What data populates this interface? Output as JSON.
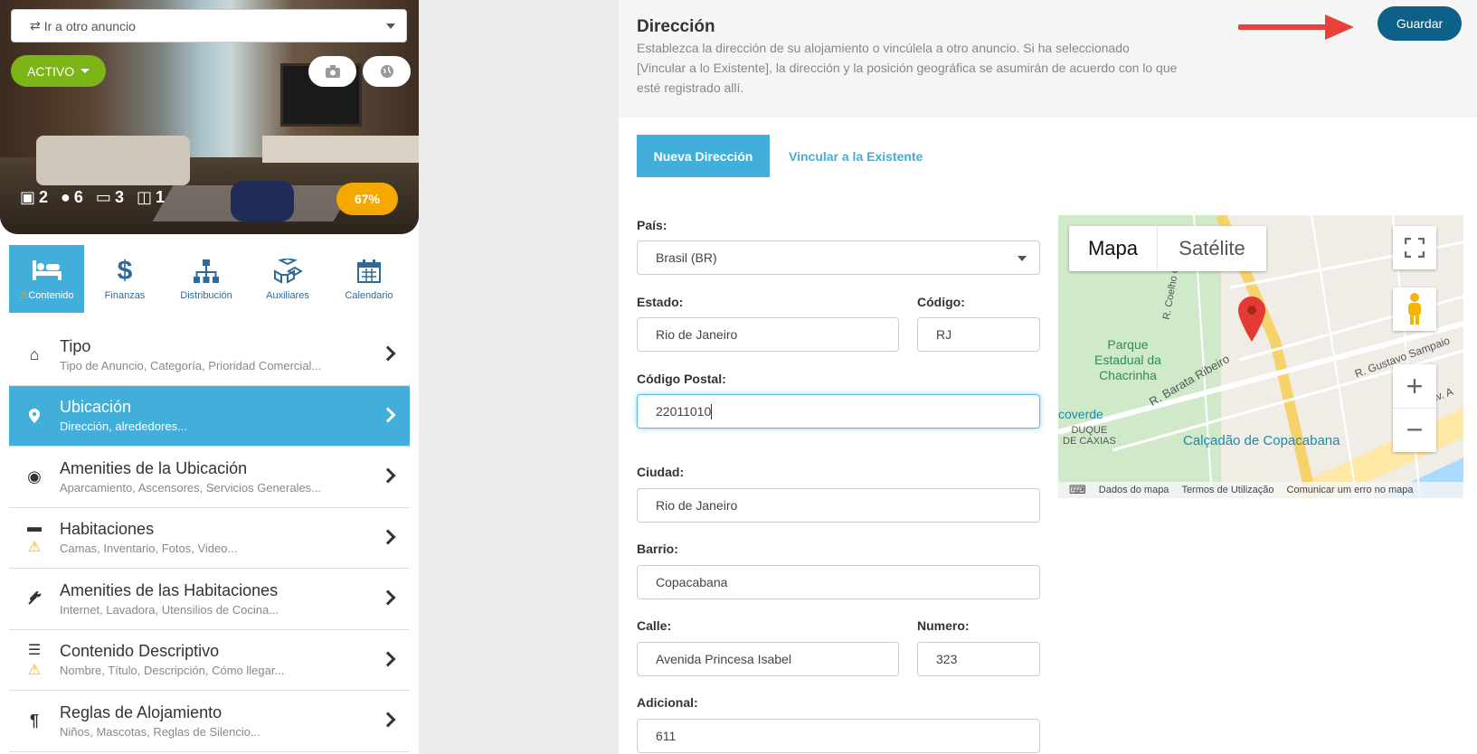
{
  "listing": {
    "go_to_placeholder": "Ir a otro anuncio",
    "status": "ACTIVO",
    "stats": {
      "units": "2",
      "guests": "6",
      "beds": "3",
      "baths": "1"
    },
    "completion": "67%",
    "completion_value": 0.67
  },
  "tabs": [
    {
      "label": "Contenido",
      "icon": "bed-icon",
      "active": true,
      "warning": true
    },
    {
      "label": "Finanzas",
      "icon": "dollar-icon"
    },
    {
      "label": "Distribución",
      "icon": "sitemap-icon"
    },
    {
      "label": "Auxiliares",
      "icon": "cubes-icon"
    },
    {
      "label": "Calendario",
      "icon": "calendar-icon"
    }
  ],
  "menu": [
    {
      "title": "Tipo",
      "subtitle": "Tipo de Anuncio, Categoría, Prioridad Comercial...",
      "icon": "home-icon"
    },
    {
      "title": "Ubicación",
      "subtitle": "Dirección, alrededores...",
      "icon": "map-pin-icon",
      "active": true
    },
    {
      "title": "Amenities de la Ubicación",
      "subtitle": "Aparcamiento, Ascensores, Servicios Generales...",
      "icon": "target-icon"
    },
    {
      "title": "Habitaciones",
      "subtitle": "Camas, Inventario, Fotos, Video...",
      "icon": "bed-icon",
      "warning": true
    },
    {
      "title": "Amenities de las Habitaciones",
      "subtitle": "Internet, Lavadora, Utensilios de Cocina...",
      "icon": "plug-icon"
    },
    {
      "title": "Contenido Descriptivo",
      "subtitle": "Nombre, Título, Descripción, Cómo llegar...",
      "icon": "align-left-icon",
      "warning": true
    },
    {
      "title": "Reglas de Alojamiento",
      "subtitle": "Niños, Mascotas, Reglas de Silencio...",
      "icon": "pilcrow-icon"
    }
  ],
  "header": {
    "title": "Dirección",
    "description": "Establezca la dirección de su alojamiento o vincúlela a otro anuncio. Si ha seleccionado [Vincular a lo Existente], la dirección y la posición geográfica se asumirán de acuerdo con lo que esté registrado allí.",
    "save_label": "Guardar"
  },
  "address_tabs": {
    "new": "Nueva Dirección",
    "link": "Vincular a la Existente"
  },
  "form": {
    "country_label": "País:",
    "country_value": "Brasil (BR)",
    "state_label": "Estado:",
    "state_value": "Rio de Janeiro",
    "code_label": "Código:",
    "code_value": "RJ",
    "postal_label": "Código Postal:",
    "postal_value": "22011010",
    "city_label": "Ciudad:",
    "city_value": "Rio de Janeiro",
    "district_label": "Barrio:",
    "district_value": "Copacabana",
    "street_label": "Calle:",
    "street_value": "Avenida Princesa Isabel",
    "number_label": "Numero:",
    "number_value": "323",
    "additional_label": "Adicional:",
    "additional_value": "611"
  },
  "map": {
    "type_map": "Mapa",
    "type_satellite": "Satélite",
    "labels": {
      "park": "Parque\nEstadual da\nChacrinha",
      "street1": "R. Barata Ribeiro",
      "street2": "R. Gustavo Sampaio",
      "street3": "Av. A",
      "street4": "R. Coelho C",
      "place1": "Calçadão de Copacabana",
      "place2": "coverde",
      "place3": "DUQUE\nDE CAXIAS"
    },
    "footer": {
      "data": "Dados do mapa",
      "terms": "Termos de Utilização",
      "report": "Comunicar um erro no mapa"
    }
  }
}
